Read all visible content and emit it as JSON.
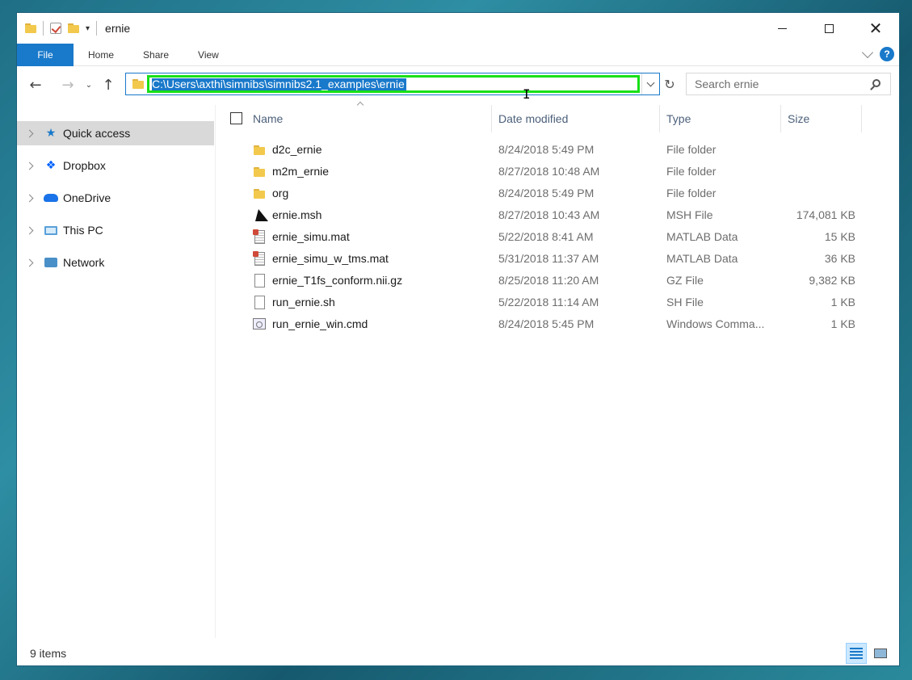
{
  "window": {
    "title": "ernie"
  },
  "ribbon": {
    "tabs": [
      {
        "label": "File"
      },
      {
        "label": "Home"
      },
      {
        "label": "Share"
      },
      {
        "label": "View"
      }
    ],
    "help_label": "?"
  },
  "address_bar": {
    "path": "C:\\Users\\axthi\\simnibs\\simnibs2.1_examples\\ernie"
  },
  "search": {
    "placeholder": "Search ernie"
  },
  "navigation_pane": {
    "items": [
      {
        "label": "Quick access",
        "icon": "star-icon",
        "selected": true
      },
      {
        "label": "Dropbox",
        "icon": "dropbox-icon"
      },
      {
        "label": "OneDrive",
        "icon": "onedrive-icon"
      },
      {
        "label": "This PC",
        "icon": "computer-icon"
      },
      {
        "label": "Network",
        "icon": "network-icon"
      }
    ]
  },
  "columns": {
    "name": "Name",
    "date": "Date modified",
    "type": "Type",
    "size": "Size"
  },
  "files": [
    {
      "name": "d2c_ernie",
      "date": "8/24/2018 5:49 PM",
      "type": "File folder",
      "size": "",
      "icon": "folder-icon"
    },
    {
      "name": "m2m_ernie",
      "date": "8/27/2018 10:48 AM",
      "type": "File folder",
      "size": "",
      "icon": "folder-icon"
    },
    {
      "name": "org",
      "date": "8/24/2018 5:49 PM",
      "type": "File folder",
      "size": "",
      "icon": "folder-icon"
    },
    {
      "name": "ernie.msh",
      "date": "8/27/2018 10:43 AM",
      "type": "MSH File",
      "size": "174,081 KB",
      "icon": "msh-file-icon"
    },
    {
      "name": "ernie_simu.mat",
      "date": "5/22/2018 8:41 AM",
      "type": "MATLAB Data",
      "size": "15 KB",
      "icon": "matlab-file-icon"
    },
    {
      "name": "ernie_simu_w_tms.mat",
      "date": "5/31/2018 11:37 AM",
      "type": "MATLAB Data",
      "size": "36 KB",
      "icon": "matlab-file-icon"
    },
    {
      "name": "ernie_T1fs_conform.nii.gz",
      "date": "8/25/2018 11:20 AM",
      "type": "GZ File",
      "size": "9,382 KB",
      "icon": "file-icon"
    },
    {
      "name": "run_ernie.sh",
      "date": "5/22/2018 11:14 AM",
      "type": "SH File",
      "size": "1 KB",
      "icon": "file-icon"
    },
    {
      "name": "run_ernie_win.cmd",
      "date": "8/24/2018 5:45 PM",
      "type": "Windows Comma...",
      "size": "1 KB",
      "icon": "cmd-file-icon"
    }
  ],
  "status": {
    "item_count": "9 items"
  },
  "colors": {
    "accent": "#1979ca",
    "selection_outline": "#18e018"
  }
}
